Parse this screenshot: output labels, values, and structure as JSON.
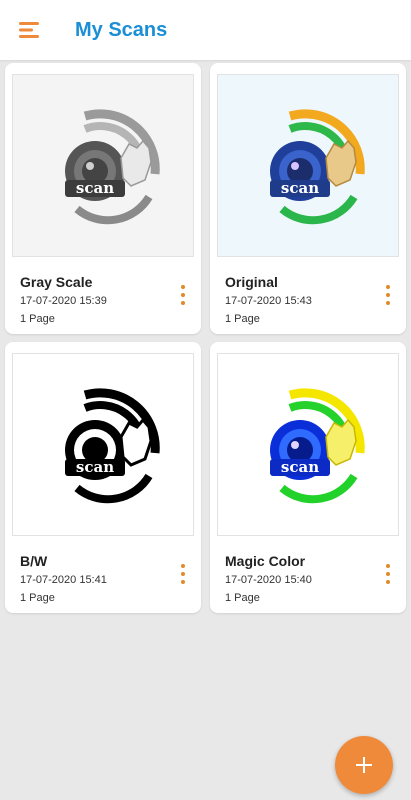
{
  "app": {
    "title": "My Scans",
    "accent_color": "#1a8fd6",
    "action_color": "#ef8a3a"
  },
  "icons": {
    "menu": "menu-icon",
    "more": "more-vertical-icon",
    "add": "plus-icon",
    "logo": "scan-logo"
  },
  "scans": [
    {
      "name": "Gray Scale",
      "date": "17-07-2020 15:39",
      "pages": "1 Page",
      "filter": "grayscale"
    },
    {
      "name": "Original",
      "date": "17-07-2020 15:43",
      "pages": "1 Page",
      "filter": "original"
    },
    {
      "name": "B/W",
      "date": "17-07-2020 15:41",
      "pages": "1 Page",
      "filter": "bw"
    },
    {
      "name": "Magic Color",
      "date": "17-07-2020 15:40",
      "pages": "1 Page",
      "filter": "magic"
    }
  ],
  "logo_text": "scan"
}
